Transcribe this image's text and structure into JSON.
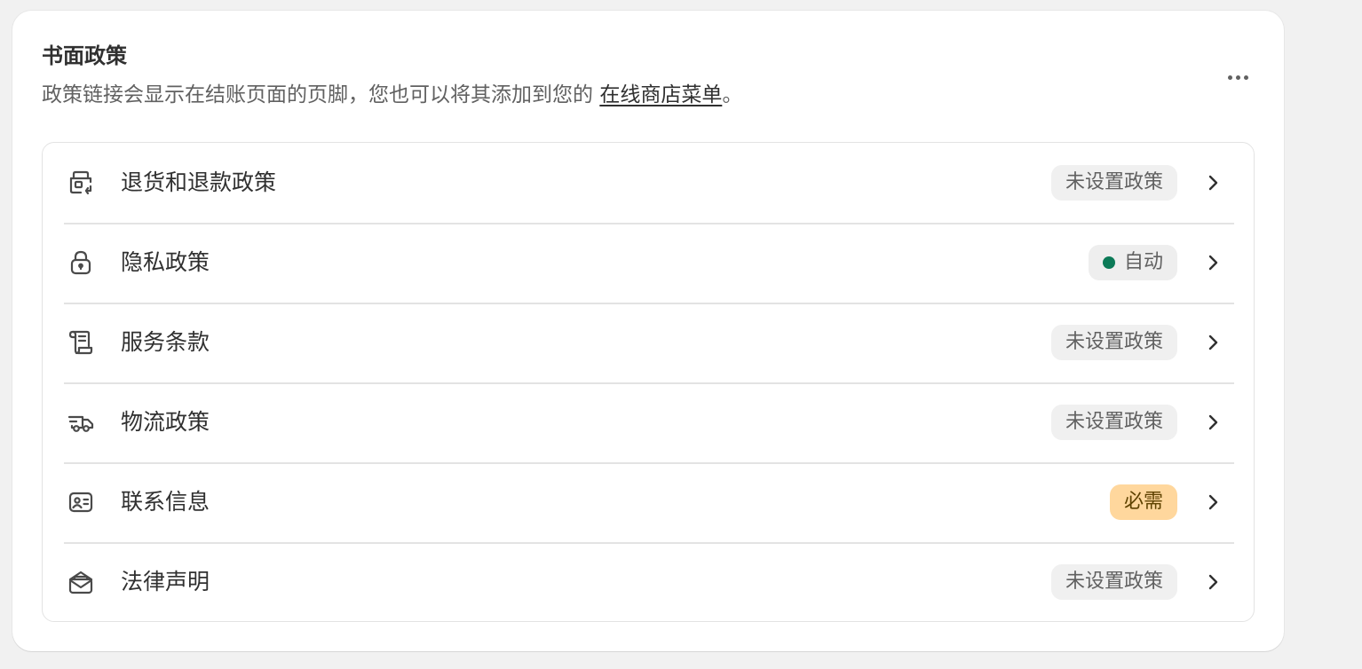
{
  "card": {
    "title": "书面政策",
    "description_prefix": "政策链接会显示在结账页面的页脚，您也可以将其添加到您的 ",
    "description_link": "在线商店菜单",
    "description_suffix": "。"
  },
  "policies": [
    {
      "label": "退货和退款政策",
      "icon": "return-box-icon",
      "status": "未设置政策",
      "status_type": "neutral"
    },
    {
      "label": "隐私政策",
      "icon": "lock-icon",
      "status": "自动",
      "status_type": "success"
    },
    {
      "label": "服务条款",
      "icon": "scroll-icon",
      "status": "未设置政策",
      "status_type": "neutral"
    },
    {
      "label": "物流政策",
      "icon": "delivery-truck-icon",
      "status": "未设置政策",
      "status_type": "neutral"
    },
    {
      "label": "联系信息",
      "icon": "contact-card-icon",
      "status": "必需",
      "status_type": "warning"
    },
    {
      "label": "法律声明",
      "icon": "envelope-icon",
      "status": "未设置政策",
      "status_type": "neutral"
    }
  ],
  "colors": {
    "success_dot": "#0c7a57",
    "warning_badge": "#ffd79d",
    "neutral_badge": "#f0f0f0"
  }
}
